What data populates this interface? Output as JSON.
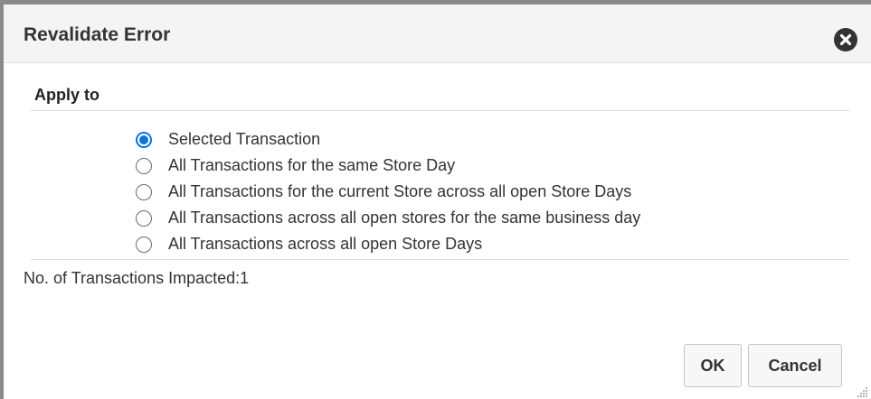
{
  "dialog": {
    "title": "Revalidate Error",
    "close_icon": "close-circle-icon"
  },
  "apply_to": {
    "heading": "Apply to",
    "selected_index": 0,
    "options": [
      {
        "label": "Selected Transaction",
        "checked": true
      },
      {
        "label": "All Transactions for the same Store Day",
        "checked": false
      },
      {
        "label": "All Transactions for the current Store across all open Store Days",
        "checked": false
      },
      {
        "label": "All Transactions across all open stores for the same business day",
        "checked": false
      },
      {
        "label": "All Transactions across all open Store Days",
        "checked": false
      }
    ]
  },
  "impact": {
    "text": "No. of Transactions Impacted:1"
  },
  "buttons": {
    "ok_label": "OK",
    "cancel_label": "Cancel"
  },
  "colors": {
    "accent": "#0a74da",
    "header_bg": "#f4f4f4",
    "text": "#333333"
  }
}
